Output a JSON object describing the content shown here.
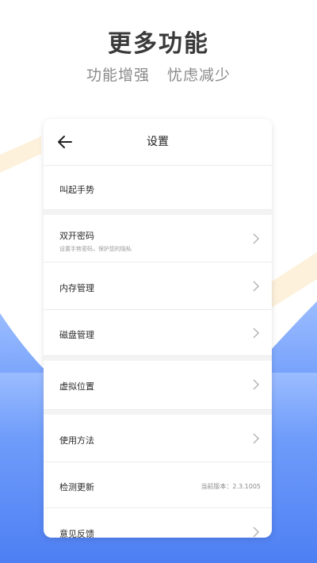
{
  "promo": {
    "headline": "更多功能",
    "subline_left": "功能增强",
    "subline_right": "忧虑减少"
  },
  "colors": {
    "accent_blue": "#4f86f7",
    "stripe": "#fdf1dc"
  },
  "settings": {
    "title": "设置",
    "back_icon": "arrow-left-icon",
    "items": {
      "gesture": {
        "label": "叫起手势"
      },
      "dual_password": {
        "label": "双开密码",
        "desc": "设置手势密码，保护您的隐私"
      },
      "memory": {
        "label": "内存管理"
      },
      "disk": {
        "label": "磁盘管理"
      },
      "virtual_location": {
        "label": "虚拟位置"
      },
      "usage": {
        "label": "使用方法"
      },
      "update": {
        "label": "检测更新",
        "value": "当前版本：2.3.1005"
      },
      "feedback": {
        "label": "意见反馈"
      }
    }
  }
}
